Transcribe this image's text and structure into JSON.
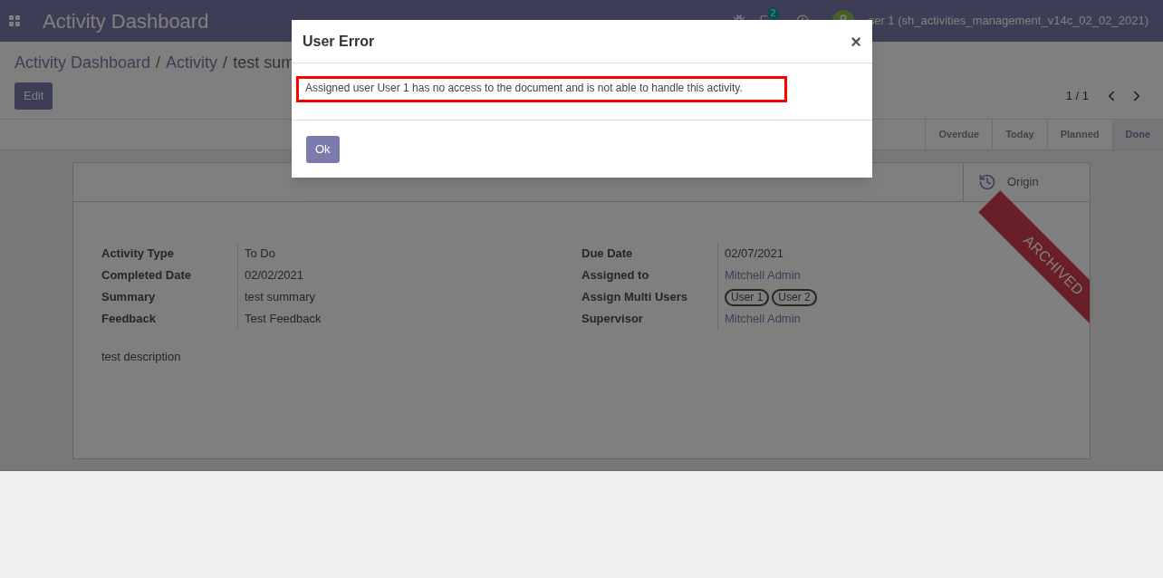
{
  "navbar": {
    "app_title": "Activity Dashboard",
    "message_count": "2",
    "user": "ser 1 (sh_activities_management_v14c_02_02_2021)"
  },
  "breadcrumb": [
    "Activity Dashboard",
    "Activity",
    "test sum"
  ],
  "breadcrumb_separator": "/",
  "edit_button": "Edit",
  "pager": "1 / 1",
  "stages": [
    {
      "label": "Overdue",
      "selected": false
    },
    {
      "label": "Today",
      "selected": false
    },
    {
      "label": "Planned",
      "selected": false
    },
    {
      "label": "Done",
      "selected": true
    }
  ],
  "origin_button": "Origin",
  "ribbon": "ARCHIVED",
  "left_fields": [
    {
      "label": "Activity Type",
      "value": "To Do"
    },
    {
      "label": "Completed Date",
      "value": "02/02/2021"
    },
    {
      "label": "Summary",
      "value": "test summary"
    },
    {
      "label": "Feedback",
      "value": "Test Feedback"
    }
  ],
  "right_fields": [
    {
      "label": "Due Date",
      "kind": "text",
      "value": "02/07/2021"
    },
    {
      "label": "Assigned to",
      "kind": "link",
      "value": "Mitchell Admin"
    },
    {
      "label": "Assign Multi Users",
      "kind": "tags",
      "tags": [
        "User 1",
        "User 2"
      ]
    },
    {
      "label": "Supervisor",
      "kind": "link",
      "value": "Mitchell Admin"
    }
  ],
  "description": "test description",
  "dialog": {
    "title": "User Error",
    "close": "×",
    "message": "Assigned user User 1 has no access to the document and is not able to handle this activity.",
    "ok": "Ok"
  }
}
